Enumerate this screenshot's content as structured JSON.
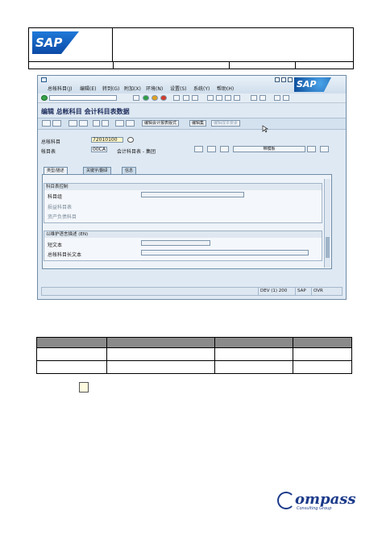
{
  "header": {
    "logo_text": "SAP"
  },
  "window": {
    "brand": "SAP",
    "menu": [
      "总帐科目(J)",
      "编辑(E)",
      "转到(G)",
      "附加(X)",
      "环境(N)",
      "设置(S)",
      "系统(Y)",
      "帮助(H)"
    ],
    "title": "编辑 总帐科目 会计科目表数据",
    "toolbar_buttons": {
      "edit_fs": "编辑会计报表版式",
      "edit_set": "编辑集",
      "edit_cost": "编辑成本要素"
    },
    "fields": {
      "gl_label": "总帐科目",
      "gl_value": "72010100",
      "coa_label": "帐目表",
      "coa_value": "00CA",
      "coa_desc": "会计科目表 - 集团",
      "template_button": "带模板"
    },
    "tabs": [
      "类型/描述",
      "关键字/翻译",
      "信息"
    ],
    "group_control": {
      "title": "科目表控制",
      "account_group_label": "科目组",
      "radio_pl": "损益科目表",
      "radio_bs": "资产负债科目"
    },
    "group_desc": {
      "title": "以维护语言描述 (EN)",
      "short_text_label": "短文本",
      "long_text_label": "总帐科目长文本"
    },
    "status": {
      "system": "DEV (1) 200",
      "server": "SAP",
      "mode": "OVR"
    }
  },
  "footer": {
    "brand": "Compass",
    "brand_letters": "ompass",
    "subtitle": "Consulting Group"
  }
}
